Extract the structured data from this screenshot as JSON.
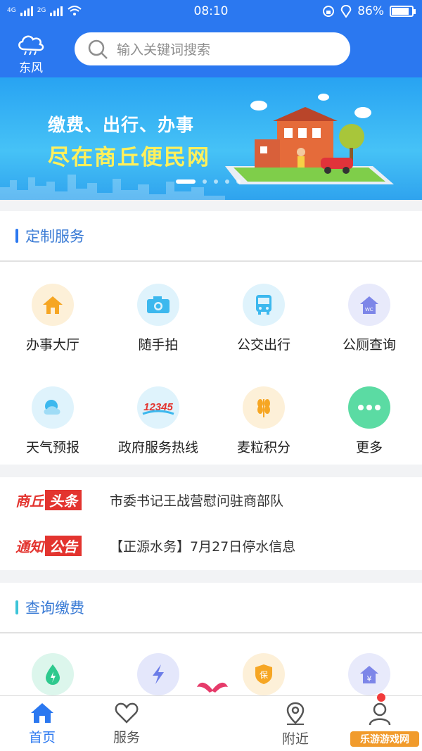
{
  "status": {
    "time": "08:10",
    "battery": "86%",
    "signal1": "4G",
    "signal2": "2G"
  },
  "header": {
    "weather_label": "东风",
    "search_placeholder": "输入关键词搜索"
  },
  "banner": {
    "line1": "缴费、出行、办事",
    "line2": "尽在商丘便民网"
  },
  "custom_services": {
    "title": "定制服务",
    "items": [
      {
        "label": "办事大厅",
        "icon": "home-icon",
        "color": "#f6a623",
        "bg": "#fdf0d8"
      },
      {
        "label": "随手拍",
        "icon": "camera-icon",
        "color": "#3cb8ee",
        "bg": "#dff3fc"
      },
      {
        "label": "公交出行",
        "icon": "bus-icon",
        "color": "#3cb8ee",
        "bg": "#dff3fc"
      },
      {
        "label": "公厕查询",
        "icon": "toilet-icon",
        "color": "#7d86e8",
        "bg": "#e8eafb"
      },
      {
        "label": "天气预报",
        "icon": "weather-icon",
        "color": "#3cb8ee",
        "bg": "#dff3fc"
      },
      {
        "label": "政府服务热线",
        "icon": "hotline-12345-icon",
        "color": "#e3342f",
        "bg": "#dff3fc"
      },
      {
        "label": "麦粒积分",
        "icon": "wheat-icon",
        "color": "#f6a623",
        "bg": "#fdf0d8"
      },
      {
        "label": "更多",
        "icon": "more-icon",
        "color": "#4dd79b",
        "bg": "#5bdba3"
      }
    ]
  },
  "news": [
    {
      "tag_a": "商丘",
      "tag_b": "头条",
      "text": "市委书记王战营慰问驻商部队"
    },
    {
      "tag_a": "通知",
      "tag_b": "公告",
      "text": "【正源水务】7月27日停水信息"
    }
  ],
  "query_pay": {
    "title": "查询缴费",
    "items": [
      {
        "icon": "water-icon",
        "color": "#2ec98e",
        "bg": "#dcf6ec"
      },
      {
        "icon": "electric-icon",
        "color": "#6b7ce8",
        "bg": "#e4e7fb"
      },
      {
        "icon": "insurance-icon",
        "color": "#f6a623",
        "bg": "#fdf0d8"
      },
      {
        "icon": "housing-fund-icon",
        "color": "#7d86e8",
        "bg": "#e8eafb"
      }
    ]
  },
  "tabbar": {
    "tabs": [
      {
        "label": "首页"
      },
      {
        "label": "服务"
      },
      {
        "label": ""
      },
      {
        "label": "附近"
      },
      {
        "label": "我的"
      }
    ]
  },
  "accent_color": "#2b78f0",
  "watermark": "乐游游戏网"
}
